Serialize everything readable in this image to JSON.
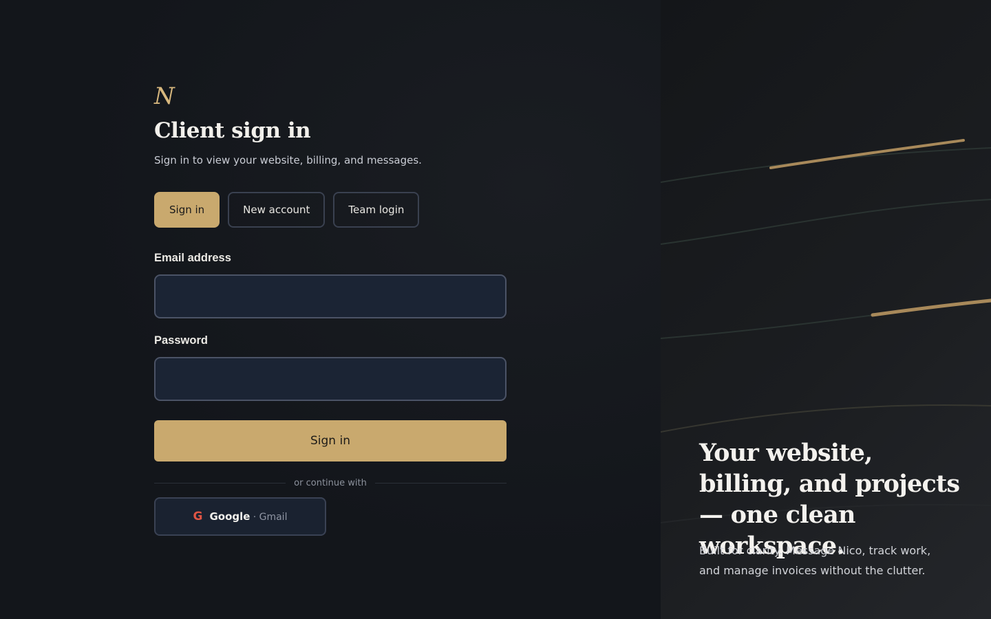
{
  "brand": {
    "mark": "N"
  },
  "header": {
    "title": "Client sign in",
    "subtitle": "Sign in to view your website, billing, and messages."
  },
  "tabs": [
    {
      "label": "Sign in",
      "active": true
    },
    {
      "label": "New account",
      "active": false
    },
    {
      "label": "Team login",
      "active": false
    }
  ],
  "form": {
    "email_label": "Email address",
    "email_value": "",
    "password_label": "Password",
    "password_value": "",
    "submit_label": "Sign in"
  },
  "divider_text": "or continue with",
  "oauth": {
    "icon": "google-g-icon",
    "provider": "Google",
    "sub_label": "· Gmail"
  },
  "hero": {
    "heading": "Your website, billing, and projects — one clean workspace.",
    "body": "Built for clarity. Message Nico, track work, and manage invoices without the clutter."
  },
  "colors": {
    "accent": "#c9a96e",
    "background": "#13161b",
    "input_bg": "#1b2434",
    "google_red": "#e05544"
  }
}
